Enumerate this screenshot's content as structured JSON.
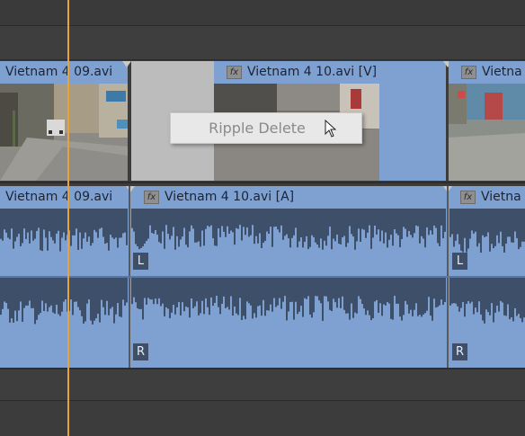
{
  "video_track": {
    "clips": [
      {
        "label": "Vietnam 4 09.avi",
        "fx": false
      },
      {
        "label": "Vietnam 4 10.avi [V]",
        "fx": true,
        "fx_icon": "fx"
      },
      {
        "label": "Vietna",
        "fx": true,
        "fx_icon": "fx"
      }
    ]
  },
  "audio_track": {
    "clips": [
      {
        "label": "Vietnam 4 09.avi",
        "fx": false
      },
      {
        "label": "Vietnam 4 10.avi [A]",
        "fx": true,
        "fx_icon": "fx"
      },
      {
        "label": "Vietna",
        "fx": true,
        "fx_icon": "fx"
      }
    ],
    "channel_left": "L",
    "channel_right": "R"
  },
  "context_menu": {
    "items": [
      {
        "label": "Ripple Delete",
        "enabled": false
      }
    ]
  },
  "colors": {
    "clip_blue": "#7fa1d2",
    "waveform": "#3d4f69",
    "playhead": "#e8a23a",
    "gap": "#bcbcbc"
  },
  "icons": {
    "cursor": "arrow-cursor-icon",
    "fx": "fx-badge-icon"
  }
}
